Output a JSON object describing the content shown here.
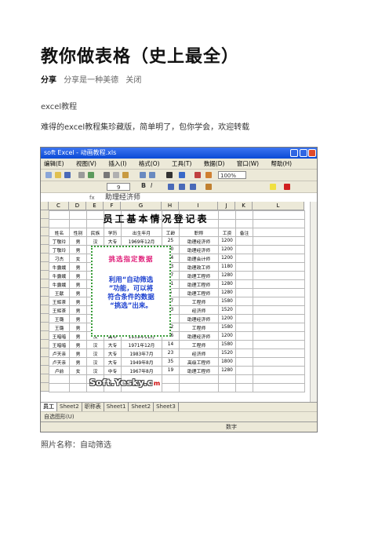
{
  "doc": {
    "title": "教你做表格（史上最全）",
    "share_label": "分享",
    "share_text": "分享是一种美德",
    "close_label": "关闭",
    "section": "excel教程",
    "intro": "难得的excel教程集珍藏版，简单明了，包你学会，欢迎转载",
    "caption": "照片名称：自动筛选"
  },
  "excel": {
    "window_title": "soft Excel - 动画教程.xls",
    "menus": [
      "编辑(E)",
      "视图(V)",
      "插入(I)",
      "格式(O)",
      "工具(T)",
      "数据(D)",
      "窗口(W)",
      "帮助(H)"
    ],
    "zoom": "100%",
    "font_size": "9",
    "formula": "助理经济师",
    "columns": [
      "C",
      "D",
      "E",
      "F",
      "G",
      "H",
      "I",
      "J",
      "K",
      "L"
    ],
    "sheet_title": "员工基本情况登记表",
    "headers": [
      "姓名",
      "性别",
      "民族",
      "学历",
      "出生年月",
      "工龄",
      "职称",
      "工资",
      "备注"
    ],
    "rows": [
      [
        "丁敬玲",
        "男",
        "汉",
        "大专",
        "1969年12月",
        "25",
        "助理经济师",
        "1200",
        ""
      ],
      [
        "丁敬玲",
        "男",
        "",
        "",
        "月",
        "30",
        "助理经济师",
        "1200",
        ""
      ],
      [
        "刁杰",
        "女",
        "",
        "",
        "月",
        "24",
        "助理会计师",
        "1200",
        ""
      ],
      [
        "牛露娥",
        "男",
        "",
        "",
        "月",
        "23",
        "助理政工师",
        "1180",
        ""
      ],
      [
        "牛露娥",
        "男",
        "",
        "",
        "月",
        "37",
        "助理工程师",
        "1280",
        ""
      ],
      [
        "牛露娥",
        "男",
        "",
        "",
        "月",
        "21",
        "助理工程师",
        "1280",
        ""
      ],
      [
        "王献",
        "男",
        "",
        "",
        "2月",
        "5",
        "助理工程师",
        "1280",
        ""
      ],
      [
        "王辉茶",
        "男",
        "",
        "",
        "2月",
        "17",
        "工程师",
        "1580",
        ""
      ],
      [
        "王辉茶",
        "男",
        "",
        "",
        "月",
        "43",
        "经济师",
        "1520",
        ""
      ],
      [
        "王璐",
        "男",
        "",
        "",
        "",
        "",
        "助理经济师",
        "1200",
        ""
      ],
      [
        "王璐",
        "男",
        "汉",
        "中专",
        "1983年7月",
        "22",
        "工程师",
        "1580",
        ""
      ],
      [
        "王暗暗",
        "男",
        "汉",
        "高中",
        "1959年11月",
        "26",
        "助理经济师",
        "1200",
        ""
      ],
      [
        "王暗暗",
        "男",
        "汉",
        "大专",
        "1971年12月",
        "14",
        "工程师",
        "1580",
        ""
      ],
      [
        "卢天亲",
        "男",
        "汉",
        "大专",
        "1983年7月",
        "23",
        "经济师",
        "1520",
        ""
      ],
      [
        "卢天亲",
        "男",
        "汉",
        "大专",
        "1949年8月",
        "35",
        "高级工程师",
        "1800",
        ""
      ],
      [
        "卢前",
        "女",
        "汉",
        "中专",
        "1967年8月",
        "19",
        "助理工程师",
        "1280",
        ""
      ]
    ],
    "popup_title": "挑选指定数据",
    "popup_lines": [
      "利用“自动筛选",
      "”功能，可以将",
      "符合条件的数据",
      "“挑选”出来。"
    ],
    "watermark": "Soft.Yesky.c",
    "watermark_mark": "m",
    "tabs": [
      "员工",
      "Sheet2",
      "职称表",
      "Sheet1",
      "Sheet2",
      "Sheet3"
    ],
    "draw_label": "自选图形(U)",
    "status": "数字"
  }
}
